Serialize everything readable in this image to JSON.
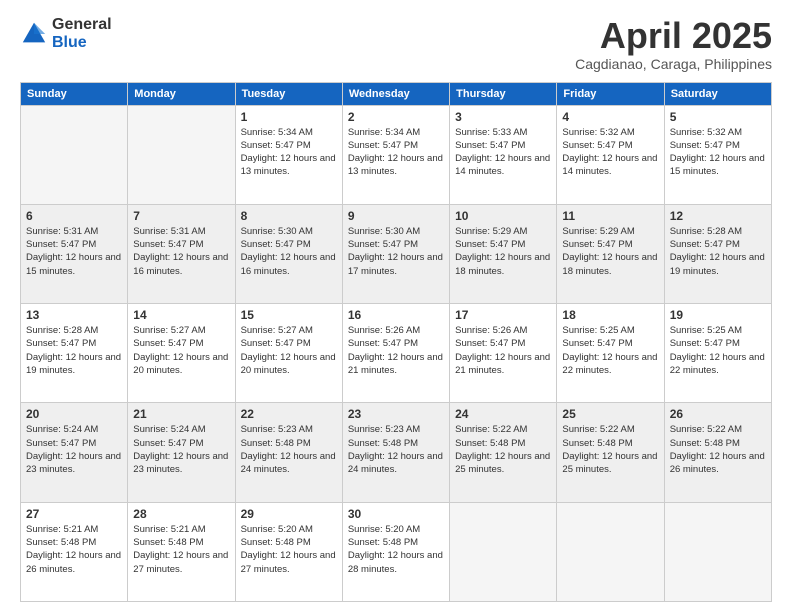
{
  "logo": {
    "general": "General",
    "blue": "Blue"
  },
  "title": "April 2025",
  "subtitle": "Cagdianao, Caraga, Philippines",
  "days_of_week": [
    "Sunday",
    "Monday",
    "Tuesday",
    "Wednesday",
    "Thursday",
    "Friday",
    "Saturday"
  ],
  "weeks": [
    [
      {
        "day": "",
        "info": ""
      },
      {
        "day": "",
        "info": ""
      },
      {
        "day": "1",
        "info": "Sunrise: 5:34 AM\nSunset: 5:47 PM\nDaylight: 12 hours and 13 minutes."
      },
      {
        "day": "2",
        "info": "Sunrise: 5:34 AM\nSunset: 5:47 PM\nDaylight: 12 hours and 13 minutes."
      },
      {
        "day": "3",
        "info": "Sunrise: 5:33 AM\nSunset: 5:47 PM\nDaylight: 12 hours and 14 minutes."
      },
      {
        "day": "4",
        "info": "Sunrise: 5:32 AM\nSunset: 5:47 PM\nDaylight: 12 hours and 14 minutes."
      },
      {
        "day": "5",
        "info": "Sunrise: 5:32 AM\nSunset: 5:47 PM\nDaylight: 12 hours and 15 minutes."
      }
    ],
    [
      {
        "day": "6",
        "info": "Sunrise: 5:31 AM\nSunset: 5:47 PM\nDaylight: 12 hours and 15 minutes."
      },
      {
        "day": "7",
        "info": "Sunrise: 5:31 AM\nSunset: 5:47 PM\nDaylight: 12 hours and 16 minutes."
      },
      {
        "day": "8",
        "info": "Sunrise: 5:30 AM\nSunset: 5:47 PM\nDaylight: 12 hours and 16 minutes."
      },
      {
        "day": "9",
        "info": "Sunrise: 5:30 AM\nSunset: 5:47 PM\nDaylight: 12 hours and 17 minutes."
      },
      {
        "day": "10",
        "info": "Sunrise: 5:29 AM\nSunset: 5:47 PM\nDaylight: 12 hours and 18 minutes."
      },
      {
        "day": "11",
        "info": "Sunrise: 5:29 AM\nSunset: 5:47 PM\nDaylight: 12 hours and 18 minutes."
      },
      {
        "day": "12",
        "info": "Sunrise: 5:28 AM\nSunset: 5:47 PM\nDaylight: 12 hours and 19 minutes."
      }
    ],
    [
      {
        "day": "13",
        "info": "Sunrise: 5:28 AM\nSunset: 5:47 PM\nDaylight: 12 hours and 19 minutes."
      },
      {
        "day": "14",
        "info": "Sunrise: 5:27 AM\nSunset: 5:47 PM\nDaylight: 12 hours and 20 minutes."
      },
      {
        "day": "15",
        "info": "Sunrise: 5:27 AM\nSunset: 5:47 PM\nDaylight: 12 hours and 20 minutes."
      },
      {
        "day": "16",
        "info": "Sunrise: 5:26 AM\nSunset: 5:47 PM\nDaylight: 12 hours and 21 minutes."
      },
      {
        "day": "17",
        "info": "Sunrise: 5:26 AM\nSunset: 5:47 PM\nDaylight: 12 hours and 21 minutes."
      },
      {
        "day": "18",
        "info": "Sunrise: 5:25 AM\nSunset: 5:47 PM\nDaylight: 12 hours and 22 minutes."
      },
      {
        "day": "19",
        "info": "Sunrise: 5:25 AM\nSunset: 5:47 PM\nDaylight: 12 hours and 22 minutes."
      }
    ],
    [
      {
        "day": "20",
        "info": "Sunrise: 5:24 AM\nSunset: 5:47 PM\nDaylight: 12 hours and 23 minutes."
      },
      {
        "day": "21",
        "info": "Sunrise: 5:24 AM\nSunset: 5:47 PM\nDaylight: 12 hours and 23 minutes."
      },
      {
        "day": "22",
        "info": "Sunrise: 5:23 AM\nSunset: 5:48 PM\nDaylight: 12 hours and 24 minutes."
      },
      {
        "day": "23",
        "info": "Sunrise: 5:23 AM\nSunset: 5:48 PM\nDaylight: 12 hours and 24 minutes."
      },
      {
        "day": "24",
        "info": "Sunrise: 5:22 AM\nSunset: 5:48 PM\nDaylight: 12 hours and 25 minutes."
      },
      {
        "day": "25",
        "info": "Sunrise: 5:22 AM\nSunset: 5:48 PM\nDaylight: 12 hours and 25 minutes."
      },
      {
        "day": "26",
        "info": "Sunrise: 5:22 AM\nSunset: 5:48 PM\nDaylight: 12 hours and 26 minutes."
      }
    ],
    [
      {
        "day": "27",
        "info": "Sunrise: 5:21 AM\nSunset: 5:48 PM\nDaylight: 12 hours and 26 minutes."
      },
      {
        "day": "28",
        "info": "Sunrise: 5:21 AM\nSunset: 5:48 PM\nDaylight: 12 hours and 27 minutes."
      },
      {
        "day": "29",
        "info": "Sunrise: 5:20 AM\nSunset: 5:48 PM\nDaylight: 12 hours and 27 minutes."
      },
      {
        "day": "30",
        "info": "Sunrise: 5:20 AM\nSunset: 5:48 PM\nDaylight: 12 hours and 28 minutes."
      },
      {
        "day": "",
        "info": ""
      },
      {
        "day": "",
        "info": ""
      },
      {
        "day": "",
        "info": ""
      }
    ]
  ]
}
